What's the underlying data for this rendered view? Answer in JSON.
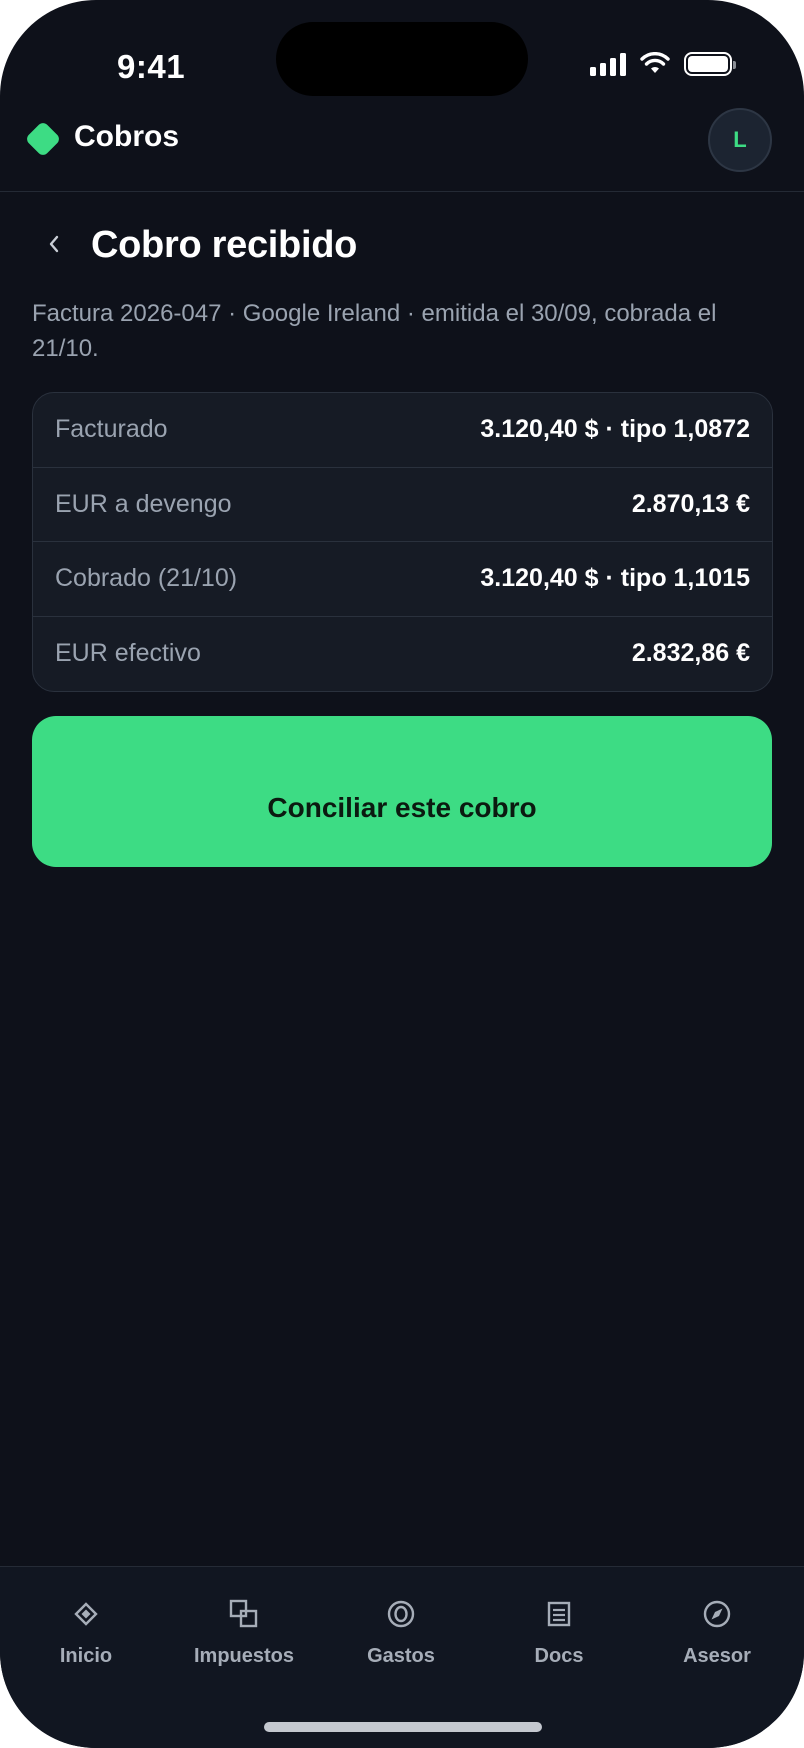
{
  "status_bar": {
    "time": "9:41"
  },
  "app_bar": {
    "title": "Cobros",
    "avatar_initial": "L"
  },
  "page": {
    "title": "Cobro recibido",
    "subtitle": "Factura 2026-047 · Google Ireland · emitida el 30/09, cobrada el 21/10."
  },
  "details": [
    {
      "label": "Facturado",
      "value": "3.120,40 $ · tipo 1,0872"
    },
    {
      "label": "EUR a devengo",
      "value": "2.870,13 €"
    },
    {
      "label": "Cobrado (21/10)",
      "value": "3.120,40 $ · tipo 1,1015"
    },
    {
      "label": "EUR efectivo",
      "value": "2.832,86 €"
    }
  ],
  "cta": {
    "label": "Conciliar este cobro"
  },
  "bottom_nav": [
    {
      "label": "Inicio",
      "icon": "diamond-icon"
    },
    {
      "label": "Impuestos",
      "icon": "squares-icon"
    },
    {
      "label": "Gastos",
      "icon": "coin-icon"
    },
    {
      "label": "Docs",
      "icon": "document-icon"
    },
    {
      "label": "Asesor",
      "icon": "compass-icon"
    }
  ],
  "colors": {
    "accent": "#3ddc84",
    "background": "#0e111a",
    "card": "#161b25"
  }
}
